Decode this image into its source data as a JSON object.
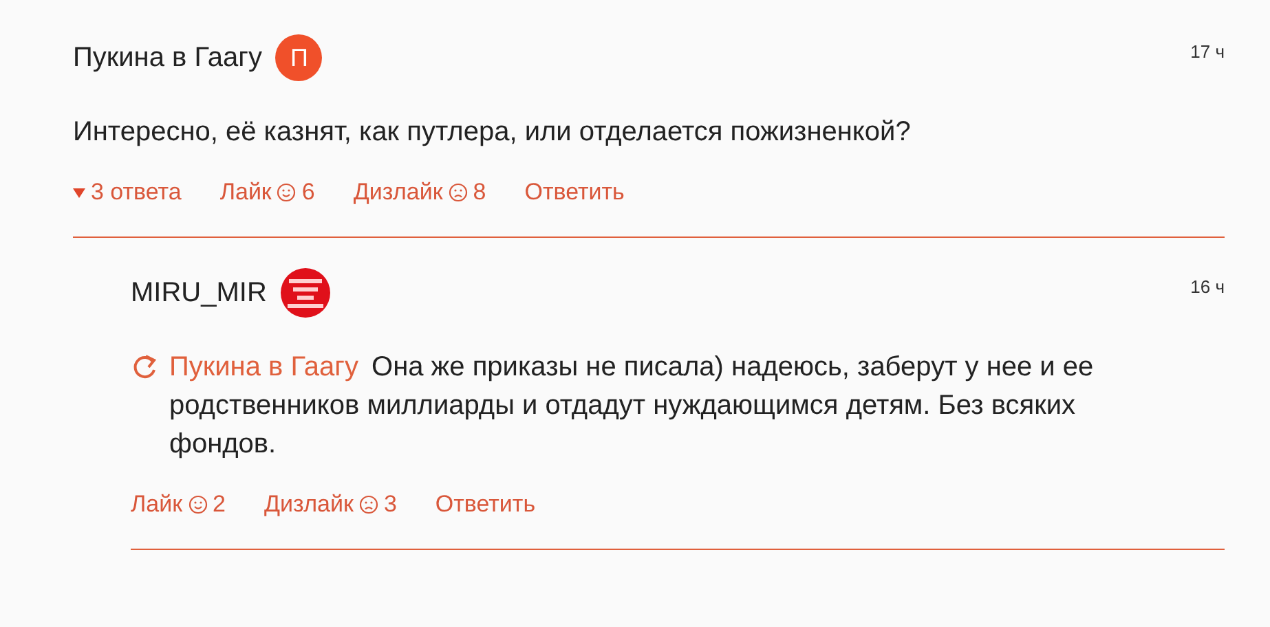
{
  "comments": [
    {
      "author": "Пукина в Гаагу",
      "avatar": {
        "kind": "letter",
        "letter": "П"
      },
      "time": "17 ч",
      "text": "Интересно, её казнят, как путлера, или отделается пожизненкой?",
      "replies_toggle": {
        "label": "3 ответа",
        "expanded": true
      },
      "like": {
        "label": "Лайк",
        "count": "6"
      },
      "dislike": {
        "label": "Дизлайк",
        "count": "8"
      },
      "reply_label": "Ответить",
      "indented": false
    },
    {
      "author": "MIRU_MIR",
      "time": "16 ч",
      "reply_to": "Пукина в Гаагу",
      "text": "Она же приказы не писала) надеюсь, заберут у нее и ее родственников миллиарды и отдадут нуждающимся детям. Без всяких фондов.",
      "like": {
        "label": "Лайк",
        "count": "2"
      },
      "dislike": {
        "label": "Дизлайк",
        "count": "3"
      },
      "reply_label": "Ответить",
      "indented": true
    }
  ]
}
